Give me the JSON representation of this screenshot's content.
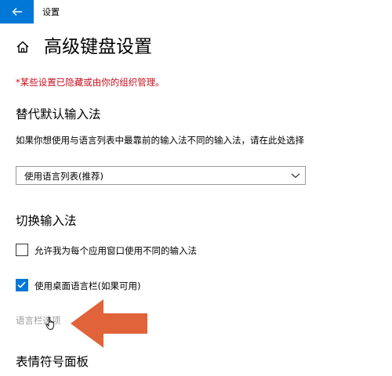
{
  "window": {
    "title": "设置"
  },
  "page": {
    "title": "高级键盘设置",
    "policy_note": "*某些设置已隐藏或由你的组织管理。"
  },
  "sections": {
    "default_input": {
      "heading": "替代默认输入法",
      "description": "如果你想使用与语言列表中最靠前的输入法不同的输入法，请在此处选择",
      "dropdown_value": "使用语言列表(推荐)"
    },
    "switch_input": {
      "heading": "切换输入法",
      "per_app_label": "允许我为每个应用窗口使用不同的输入法",
      "per_app_checked": false,
      "language_bar_label": "使用桌面语言栏(如果可用)",
      "language_bar_checked": true,
      "language_bar_options_link": "语言栏选项"
    },
    "emoji": {
      "heading": "表情符号面板"
    }
  },
  "icons": {
    "back": "back-arrow-icon",
    "home": "home-icon",
    "chevron": "chevron-down-icon",
    "check": "checkmark-icon",
    "annotation": "annotation-arrow-icon",
    "cursor": "hand-cursor-icon"
  },
  "colors": {
    "accent": "#0078d7",
    "policy_note": "#c50f1f",
    "disabled_text": "#9a9a9a",
    "annotation_arrow": "#e0633a"
  }
}
